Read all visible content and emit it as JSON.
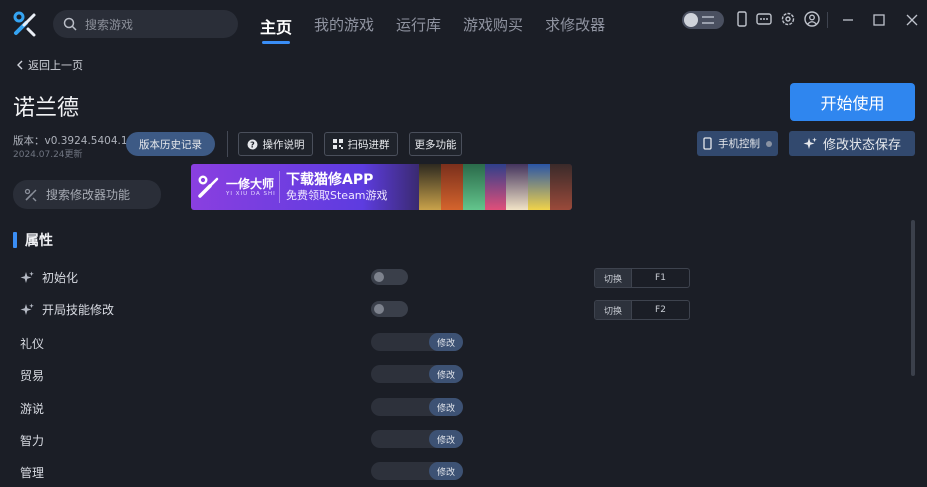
{
  "search": {
    "placeholder": "搜索游戏"
  },
  "nav": [
    {
      "label": "主页",
      "active": true
    },
    {
      "label": "我的游戏"
    },
    {
      "label": "运行库"
    },
    {
      "label": "游戏购买"
    },
    {
      "label": "求修改器"
    }
  ],
  "top_icons": [
    "theme-toggle-icon",
    "phone-icon",
    "gamepad-icon",
    "settings-icon",
    "user-icon"
  ],
  "window_controls": [
    "minimize-icon",
    "maximize-icon",
    "close-icon"
  ],
  "back_label": "返回上一页",
  "game": {
    "title": "诺兰德",
    "version": "版本：v0.3924.5404.1",
    "updated": "2024.07.24更新",
    "start_label": "开始使用"
  },
  "actions": {
    "history": "版本历史记录",
    "manual": "操作说明",
    "qr_group": "扫码进群",
    "more": "更多功能",
    "phone_control": "手机控制",
    "save_state": "修改状态保存"
  },
  "mod_search": {
    "placeholder": "搜索修改器功能"
  },
  "banner": {
    "brand": "一修大师",
    "brand_sub": "YI XIU DA SHI",
    "title": "下载猫修APP",
    "desc": "免费领取Steam游戏"
  },
  "section_title": "属性",
  "toggles": [
    {
      "label": "初始化",
      "switch_label": "切换",
      "key": "F1"
    },
    {
      "label": "开局技能修改",
      "switch_label": "切换",
      "key": "F2"
    }
  ],
  "attributes": [
    {
      "label": "礼仪",
      "button": "修改"
    },
    {
      "label": "贸易",
      "button": "修改"
    },
    {
      "label": "游说",
      "button": "修改"
    },
    {
      "label": "智力",
      "button": "修改"
    },
    {
      "label": "管理",
      "button": "修改"
    }
  ],
  "colors": {
    "accent": "#2f86ef",
    "background": "#1b1e26"
  }
}
